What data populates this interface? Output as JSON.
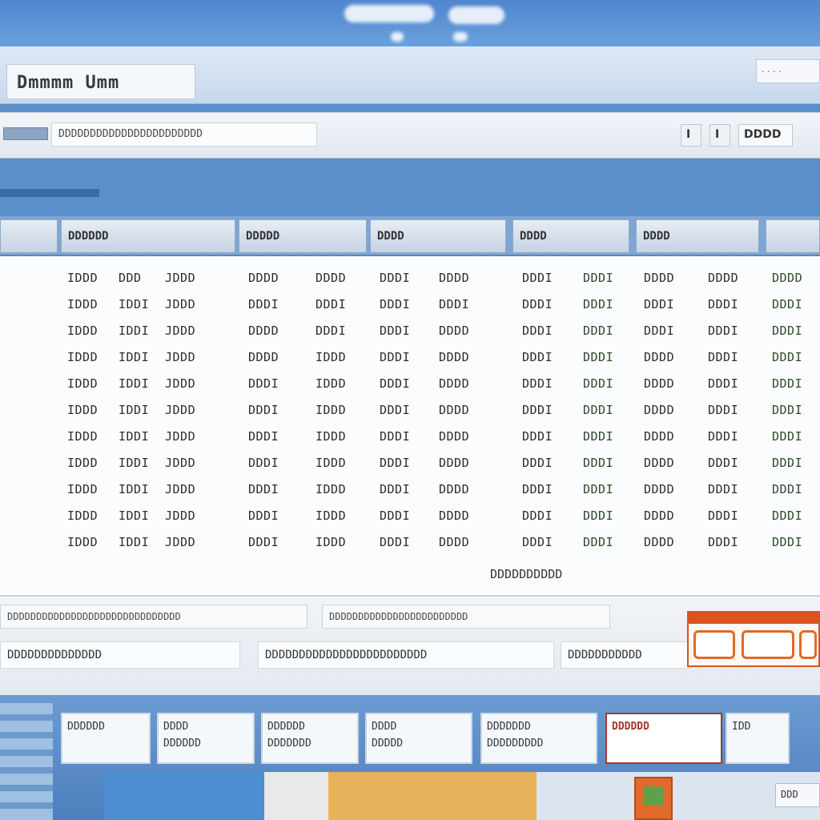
{
  "window": {
    "title": "Dmmmm Umm",
    "title_right": "· · · ·"
  },
  "address": {
    "path": "DDDDDDDDDDDDDDDDDDDDDDD",
    "nav_left": "I",
    "nav_right": "I",
    "view_label": "DDDD"
  },
  "columns": [
    {
      "label": "DDDDDD"
    },
    {
      "label": "DDDDD"
    },
    {
      "label": "DDDD"
    },
    {
      "label": "DDDD"
    },
    {
      "label": "DDDD"
    }
  ],
  "rows": [
    {
      "c": [
        "IDDD",
        "DDD",
        "JDDD",
        "DDDD",
        "DDDD",
        "DDDI",
        "DDDD",
        "DDDI",
        "DDDI",
        "DDDD",
        "DDDD",
        "DDDD"
      ]
    },
    {
      "c": [
        "IDDD",
        "IDDI",
        "JDDD",
        "DDDI",
        "DDDI",
        "DDDI",
        "DDDI",
        "DDDI",
        "DDDI",
        "DDDI",
        "DDDI",
        "DDDI"
      ]
    },
    {
      "c": [
        "IDDD",
        "IDDI",
        "JDDD",
        "DDDD",
        "DDDI",
        "DDDI",
        "DDDD",
        "DDDI",
        "DDDI",
        "DDDI",
        "DDDI",
        "DDDI"
      ]
    },
    {
      "c": [
        "IDDD",
        "IDDI",
        "JDDD",
        "DDDD",
        "IDDD",
        "DDDI",
        "DDDD",
        "DDDI",
        "DDDI",
        "DDDD",
        "DDDI",
        "DDDI"
      ]
    },
    {
      "c": [
        "IDDD",
        "IDDI",
        "JDDD",
        "DDDI",
        "IDDD",
        "DDDI",
        "DDDD",
        "DDDI",
        "DDDI",
        "DDDD",
        "DDDI",
        "DDDI"
      ]
    },
    {
      "c": [
        "IDDD",
        "IDDI",
        "JDDD",
        "DDDI",
        "IDDD",
        "DDDI",
        "DDDD",
        "DDDI",
        "DDDI",
        "DDDD",
        "DDDI",
        "DDDI"
      ]
    },
    {
      "c": [
        "IDDD",
        "IDDI",
        "JDDD",
        "DDDI",
        "IDDD",
        "DDDI",
        "DDDD",
        "DDDI",
        "DDDI",
        "DDDD",
        "DDDI",
        "DDDI"
      ]
    },
    {
      "c": [
        "IDDD",
        "IDDI",
        "JDDD",
        "DDDI",
        "IDDD",
        "DDDI",
        "DDDD",
        "DDDI",
        "DDDI",
        "DDDD",
        "DDDI",
        "DDDI"
      ]
    },
    {
      "c": [
        "IDDD",
        "IDDI",
        "JDDD",
        "DDDI",
        "IDDD",
        "DDDI",
        "DDDD",
        "DDDI",
        "DDDI",
        "DDDD",
        "DDDI",
        "DDDI"
      ]
    },
    {
      "c": [
        "IDDD",
        "IDDI",
        "JDDD",
        "DDDI",
        "IDDD",
        "DDDI",
        "DDDD",
        "DDDI",
        "DDDI",
        "DDDD",
        "DDDI",
        "DDDI"
      ]
    },
    {
      "c": [
        "IDDD",
        "IDDI",
        "JDDD",
        "DDDI",
        "IDDD",
        "DDDI",
        "DDDD",
        "DDDI",
        "DDDI",
        "DDDD",
        "DDDI",
        "DDDI"
      ]
    }
  ],
  "footer_note": "DDDDDDDDDD",
  "lower": {
    "seg1": "DDDDDDDDDDDDDDDDDDDDDDDDDDDDDD",
    "seg2": "DDDDDDDDDDDDDDDDDDDDDDDD",
    "status1": "DDDDDDDDDDDDDD",
    "status2": "DDDDDDDDDDDDDDDDDDDDDDDD",
    "status3": "DDDDDDDDDDD"
  },
  "taskbar": {
    "items": [
      {
        "label_top": "",
        "label_bottom": "DDDDDD"
      },
      {
        "label_top": "DDDD",
        "label_bottom": "DDDDDD"
      },
      {
        "label_top": "DDDDDD",
        "label_bottom": "DDDDDDD"
      },
      {
        "label_top": "DDDD",
        "label_bottom": "DDDDD"
      },
      {
        "label_top": "DDDDDDD",
        "label_bottom": "DDDDDDDDD"
      },
      {
        "label_top": "",
        "label_bottom": "DDDDDD"
      }
    ],
    "right_label": "IDD",
    "tray_label": "DDD"
  },
  "colors": {
    "accent": "#d9541e",
    "taskbar": "#5b8fca",
    "active_task": "#a43a2a"
  }
}
